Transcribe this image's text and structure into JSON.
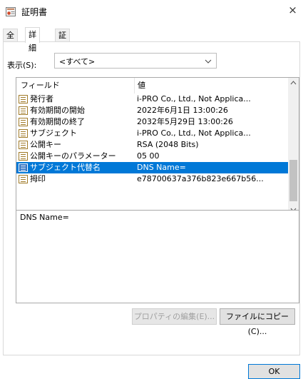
{
  "window": {
    "title": "証明書",
    "close_glyph": "×"
  },
  "tabs": [
    {
      "label": "全般"
    },
    {
      "label": "詳細"
    },
    {
      "label": "証明のパス"
    }
  ],
  "show": {
    "label": "表示(S):",
    "value": "<すべて>"
  },
  "list": {
    "headers": {
      "field": "フィールド",
      "value": "値"
    },
    "rows": [
      {
        "field": "発行者",
        "value": "i-PRO Co., Ltd., Not Applica..."
      },
      {
        "field": "有効期間の開始",
        "value": "2022年6月1日 13:00:26"
      },
      {
        "field": "有効期間の終了",
        "value": "2032年5月29日 13:00:26"
      },
      {
        "field": "サブジェクト",
        "value": "i-PRO Co., Ltd., Not Applica..."
      },
      {
        "field": "公開キー",
        "value": "RSA (2048 Bits)"
      },
      {
        "field": "公開キーのパラメーター",
        "value": "05 00"
      },
      {
        "field": "サブジェクト代替名",
        "value": "DNS Name="
      },
      {
        "field": "拇印",
        "value": "e78700637a376b823e667b56..."
      }
    ],
    "selected_index": 6
  },
  "detail": {
    "text": "DNS Name="
  },
  "buttons": {
    "edit_properties": "プロパティの編集(E)...",
    "copy_to_file": "ファイルにコピー(C)...",
    "ok": "OK"
  }
}
